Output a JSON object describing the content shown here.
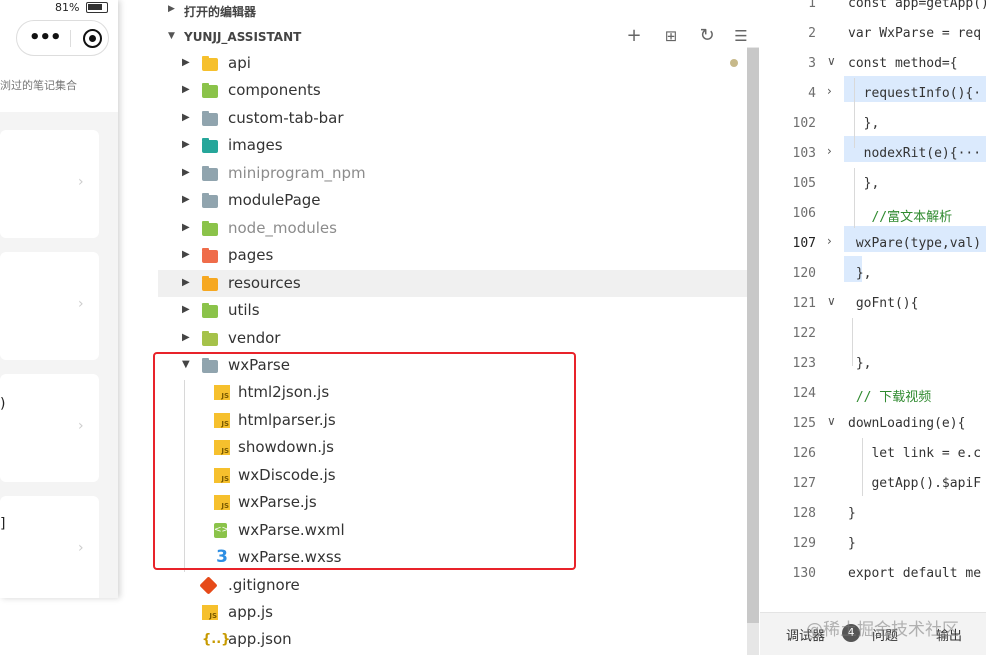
{
  "phone": {
    "battery": "81%",
    "subtitle": "浏过的笔记集合",
    "cards": [
      {
        "text": ""
      },
      {
        "text": ""
      },
      {
        "text": ")"
      },
      {
        "text": "]"
      }
    ]
  },
  "explorer": {
    "open_editors_label": "打开的编辑器",
    "project_label": "YUNJJ_ASSISTANT",
    "items": [
      {
        "name": "api",
        "icon": "api-folder-icon",
        "color": "#f6c02d",
        "expanded": false
      },
      {
        "name": "components",
        "icon": "components-folder-icon",
        "color": "#8bc34a",
        "expanded": false
      },
      {
        "name": "custom-tab-bar",
        "icon": "folder-icon",
        "color": "#90a4ae",
        "expanded": false
      },
      {
        "name": "images",
        "icon": "images-folder-icon",
        "color": "#26a69a",
        "expanded": false
      },
      {
        "name": "miniprogram_npm",
        "icon": "folder-icon",
        "color": "#90a4ae",
        "expanded": false,
        "dim": true
      },
      {
        "name": "modulePage",
        "icon": "folder-icon",
        "color": "#90a4ae",
        "expanded": false
      },
      {
        "name": "node_modules",
        "icon": "node-folder-icon",
        "color": "#8bc34a",
        "expanded": false,
        "dim": true
      },
      {
        "name": "pages",
        "icon": "pages-folder-icon",
        "color": "#ef6c4a",
        "expanded": false
      },
      {
        "name": "resources",
        "icon": "resources-folder-icon",
        "color": "#f6a821",
        "expanded": false,
        "highlight": true
      },
      {
        "name": "utils",
        "icon": "utils-folder-icon",
        "color": "#8bc34a",
        "expanded": false
      },
      {
        "name": "vendor",
        "icon": "vendor-folder-icon",
        "color": "#a5c24a",
        "expanded": false
      },
      {
        "name": "wxParse",
        "icon": "folder-open-icon",
        "color": "#90a4ae",
        "expanded": true
      },
      {
        "name": "html2json.js",
        "icon": "js-file-icon",
        "child": true
      },
      {
        "name": "htmlparser.js",
        "icon": "js-file-icon",
        "child": true
      },
      {
        "name": "showdown.js",
        "icon": "js-file-icon",
        "child": true
      },
      {
        "name": "wxDiscode.js",
        "icon": "js-file-icon",
        "child": true
      },
      {
        "name": "wxParse.js",
        "icon": "js-file-icon",
        "child": true
      },
      {
        "name": "wxParse.wxml",
        "icon": "wxml-file-icon",
        "child": true
      },
      {
        "name": "wxParse.wxss",
        "icon": "css-file-icon",
        "child": true
      },
      {
        "name": ".gitignore",
        "icon": "git-file-icon"
      },
      {
        "name": "app.js",
        "icon": "js-file-icon"
      },
      {
        "name": "app.json",
        "icon": "json-file-icon"
      }
    ],
    "actions": [
      "new-file-icon",
      "new-folder-icon",
      "refresh-icon",
      "collapse-all-icon"
    ]
  },
  "editor": {
    "lines": [
      {
        "no": "1",
        "code": "const app=getApp()"
      },
      {
        "no": "2",
        "code": "var WxParse = req"
      },
      {
        "no": "3",
        "code": "const method={"
      },
      {
        "no": "4",
        "code": "  requestInfo(){·"
      },
      {
        "no": "102",
        "code": "  },"
      },
      {
        "no": "103",
        "code": "  nodexRit(e){···"
      },
      {
        "no": "105",
        "code": "  },"
      },
      {
        "no": "106",
        "code": "   //富文本解析"
      },
      {
        "no": "107",
        "code": " wxPare(type,val)"
      },
      {
        "no": "120",
        "code": " },"
      },
      {
        "no": "121",
        "code": " goFnt(){"
      },
      {
        "no": "122",
        "code": ""
      },
      {
        "no": "123",
        "code": " },"
      },
      {
        "no": "124",
        "code": " // 下载视频"
      },
      {
        "no": "125",
        "code": "downLoading(e){"
      },
      {
        "no": "126",
        "code": "   let link = e.c"
      },
      {
        "no": "127",
        "code": "   getApp().$apiF"
      },
      {
        "no": "128",
        "code": "}"
      },
      {
        "no": "129",
        "code": "}"
      },
      {
        "no": "130",
        "code": "export default me"
      }
    ],
    "footer_tabs": [
      "调试器",
      "4",
      "问题",
      "输出"
    ],
    "watermark": "@稀土掘金技术社区"
  }
}
